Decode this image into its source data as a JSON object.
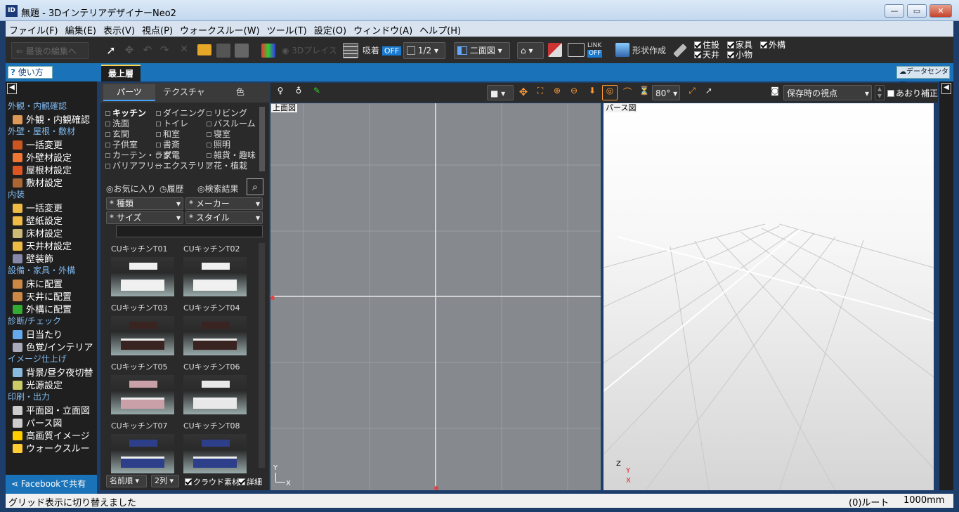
{
  "window": {
    "title": "無題 - 3DインテリアデザイナーNeo2",
    "logo": "ID",
    "min": "—",
    "max": "▭",
    "close": "✕"
  },
  "menu": [
    "ファイル(F)",
    "編集(E)",
    "表示(V)",
    "視点(P)",
    "ウォークスルー(W)",
    "ツール(T)",
    "設定(O)",
    "ウィンドウ(A)",
    "ヘルプ(H)"
  ],
  "toolbar": {
    "undo_label": "最後の編集へ",
    "place3d": "3Dプレイス",
    "snap": "吸着",
    "snap_state": "OFF",
    "grid_ratio": "1/2",
    "view_mode": "二面図",
    "link": "LINK",
    "link_state": "OFF",
    "shape": "形状作成",
    "checks": [
      {
        "label": "住設",
        "on": true
      },
      {
        "label": "天井",
        "on": true
      },
      {
        "label": "家具",
        "on": true
      },
      {
        "label": "小物",
        "on": true
      },
      {
        "label": "外構",
        "on": true
      }
    ]
  },
  "tabs": {
    "help": "使い方",
    "floor": "最上層",
    "datacenter": "データセンター"
  },
  "left": {
    "sections": [
      {
        "title": "外観・内観確認",
        "items": [
          "外観・内観確認"
        ]
      },
      {
        "title": "外壁・屋根・敷材",
        "items": [
          "一括変更",
          "外壁材設定",
          "屋根材設定",
          "敷材設定"
        ]
      },
      {
        "title": "内装",
        "items": [
          "一括変更",
          "壁紙設定",
          "床材設定",
          "天井材設定",
          "壁装飾"
        ]
      },
      {
        "title": "設備・家具・外構",
        "items": [
          "床に配置",
          "天井に配置",
          "外構に配置"
        ]
      },
      {
        "title": "診断/チェック",
        "items": [
          "日当たり",
          "色覚/インテリア"
        ]
      },
      {
        "title": "イメージ仕上げ",
        "items": [
          "背景/昼夕夜切替",
          "光源設定"
        ]
      },
      {
        "title": "印刷・出力",
        "items": [
          "平面図・立面図",
          "パース図",
          "高画質イメージ",
          "ウォークスルー"
        ]
      }
    ],
    "facebook": "Facebookで共有"
  },
  "parts": {
    "tabs": [
      "パーツ",
      "テクスチャ",
      "色"
    ],
    "categories": [
      [
        "キッチン",
        "ダイニング",
        "リビング"
      ],
      [
        "洗面",
        "トイレ",
        "バスルーム"
      ],
      [
        "玄関",
        "和室",
        "寝室"
      ],
      [
        "子供室",
        "書斎",
        "照明"
      ],
      [
        "カーテン・ラグ",
        "家電",
        "雑貨・趣味"
      ],
      [
        "バリアフリー",
        "エクステリア",
        "花・植栽"
      ]
    ],
    "filters": {
      "favorites": "お気に入り",
      "history": "履歴",
      "results": "検索結果"
    },
    "selects": {
      "type": "* 種類",
      "maker": "* メーカー",
      "size": "* サイズ",
      "style": "* スタイル"
    },
    "items": [
      "CUキッチンT01",
      "CUキッチンT02",
      "CUキッチンT03",
      "CUキッチンT04",
      "CUキッチンT05",
      "CUキッチンT06",
      "CUキッチンT07",
      "CUキッチンT08"
    ],
    "item_colors": [
      "#f0f0f0",
      "#f0f0f0",
      "#3a2422",
      "#3a2422",
      "#c9a0a8",
      "#e8e8e8",
      "#2d3f8a",
      "#2d3f8a"
    ],
    "footer": {
      "sort": "名前順",
      "cols": "2列",
      "cloud": "クラウド素材",
      "detail": "詳細"
    }
  },
  "views": {
    "angle": "80°",
    "viewpoint": "保存時の視点",
    "tilt": "あおり補正",
    "top_label": "上面図",
    "persp_label": "パース図",
    "axis_y": "Y",
    "axis_x": "X",
    "axis_z": "Z"
  },
  "status": {
    "message": "グリッド表示に切り替えました",
    "route": "(0)ルート",
    "scale": "1000mm"
  }
}
